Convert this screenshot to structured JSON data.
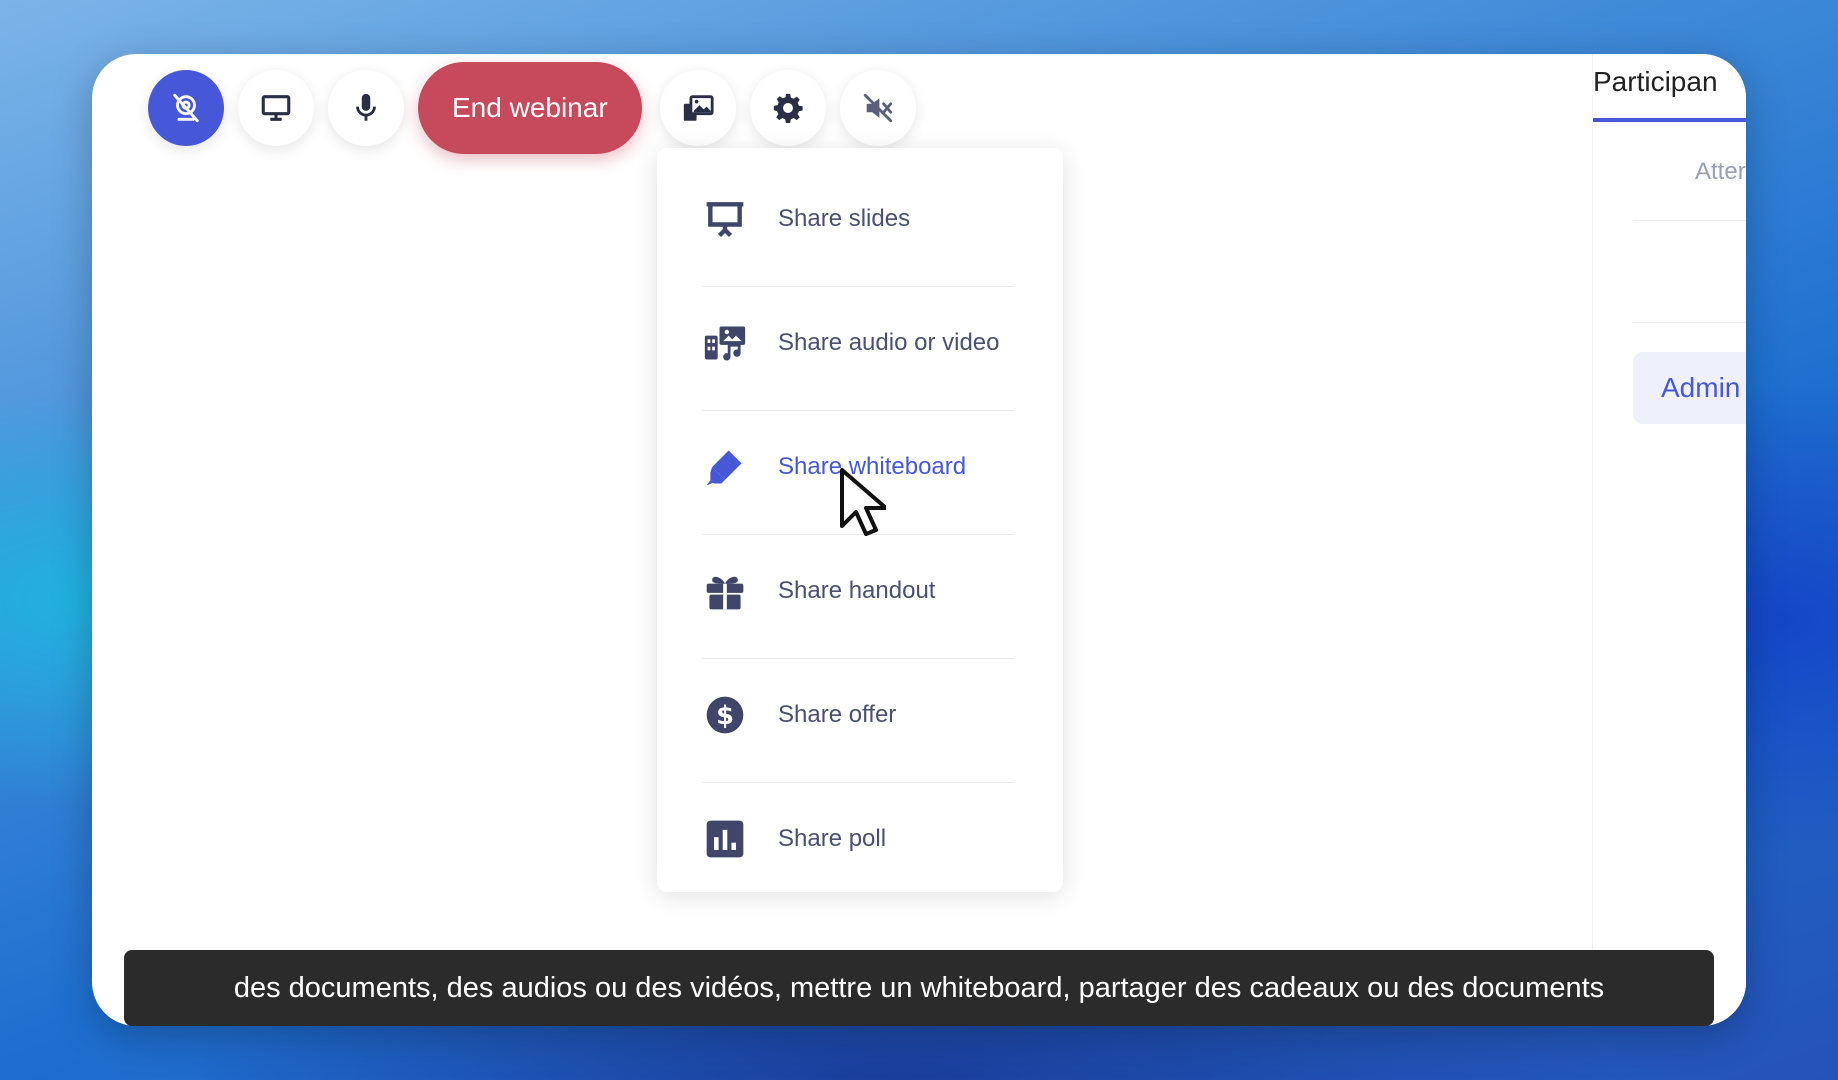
{
  "toolbar": {
    "camera_icon": "camera-off-icon",
    "screen_icon": "monitor-icon",
    "mic_icon": "microphone-icon",
    "end_label": "End webinar",
    "media_icon": "media-share-icon",
    "settings_icon": "gear-icon",
    "sound_icon": "speaker-mute-icon"
  },
  "menu": {
    "items": [
      {
        "label": "Share slides",
        "icon": "presentation-icon"
      },
      {
        "label": "Share audio or video",
        "icon": "audio-video-icon"
      },
      {
        "label": "Share whiteboard",
        "icon": "marker-icon"
      },
      {
        "label": "Share handout",
        "icon": "gift-icon"
      },
      {
        "label": "Share offer",
        "icon": "dollar-icon"
      },
      {
        "label": "Share poll",
        "icon": "poll-icon"
      }
    ],
    "active_index": 2
  },
  "side": {
    "tab_label": "Participan",
    "subtab_label": "Atter",
    "admin_label": "Admin"
  },
  "caption": "des documents, des audios ou des vidéos, mettre un whiteboard, partager des cadeaux ou des documents",
  "colors": {
    "accent": "#4658d8",
    "end_button": "#c64a5c",
    "menu_text": "#4a5170",
    "icon": "#3f4669"
  }
}
